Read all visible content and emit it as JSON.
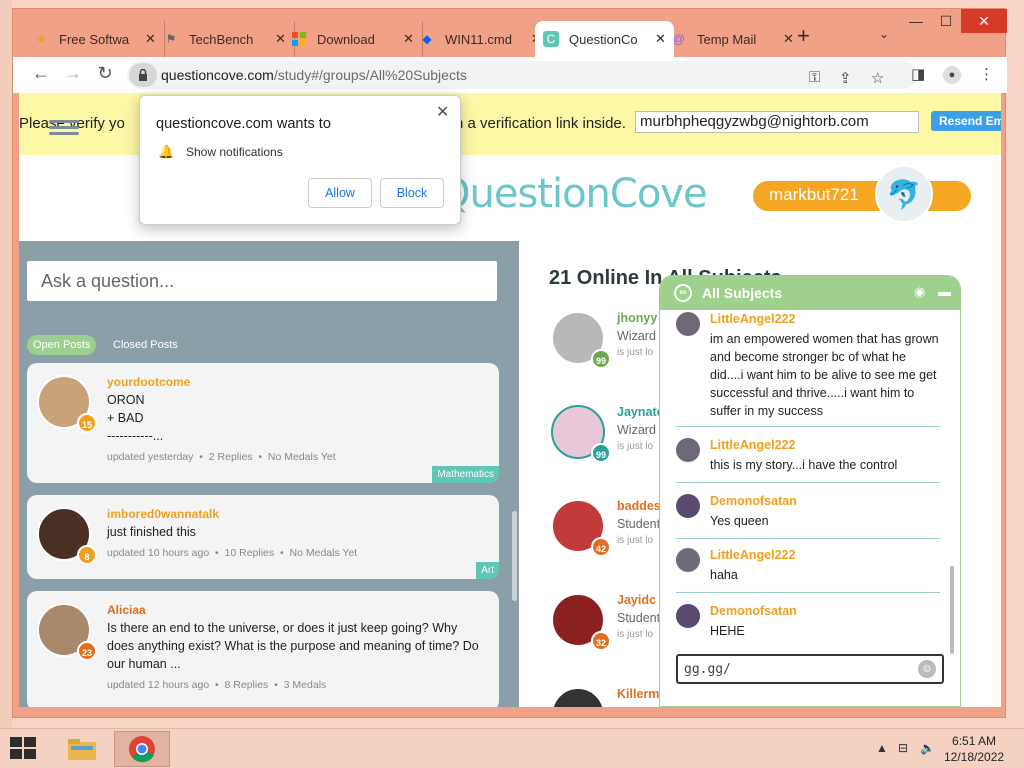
{
  "tabs": [
    {
      "label": "Free Softwa",
      "icon": "star-icon",
      "icon_color": "#f0a020"
    },
    {
      "label": "TechBench",
      "icon": "windows-icon",
      "icon_color": "#555555"
    },
    {
      "label": "Download",
      "icon": "microsoft-icon",
      "icon_color": "#00a4ef"
    },
    {
      "label": "WIN11.cmd",
      "icon": "dropbox-icon",
      "icon_color": "#0061ff"
    },
    {
      "label": "QuestionCo",
      "icon": "questioncove-icon",
      "icon_color": "#5ec8b5"
    },
    {
      "label": "Temp Mail",
      "icon": "at-icon",
      "icon_color": "#8a5cf6"
    }
  ],
  "address": {
    "domain": "questioncove.com",
    "path": "/study#/groups/All%20Subjects"
  },
  "verify": {
    "text_left": "Please verify yo",
    "text_right": "n a verification link inside.",
    "email": "murbhpheqgyzwbg@nightorb.com",
    "resend": "Resend Em"
  },
  "notification": {
    "title": "questioncove.com wants to",
    "option": "Show notifications",
    "allow": "Allow",
    "block": "Block"
  },
  "header": {
    "logo": "QuestionCove",
    "username": "markbut721"
  },
  "ask_placeholder": "Ask a question...",
  "post_tabs": {
    "open": "Open Posts",
    "closed": "Closed Posts"
  },
  "posts": [
    {
      "user": "yourdootcome",
      "level": "15",
      "body": "ORON\n+ BAD\n-----------...",
      "updated": "updated yesterday",
      "replies": "2 Replies",
      "medals": "No Medals Yet",
      "subject": "Mathematics"
    },
    {
      "user": "imbored0wannatalk",
      "level": "8",
      "body": "just finished this",
      "updated": "updated 10 hours ago",
      "replies": "10 Replies",
      "medals": "No Medals Yet",
      "subject": "Art"
    },
    {
      "user": "Aliciaa",
      "level": "23",
      "body": "Is there an end to the universe, or does it just keep going? Why does anything exist? What is the purpose and meaning of time? Do our human ...",
      "updated": "updated 12 hours ago",
      "replies": "8 Replies",
      "medals": "3 Medals",
      "subject": ""
    }
  ],
  "online": {
    "title": "21 Online In All Subjects",
    "users": [
      {
        "name": "jhonyy",
        "role": "Wizard",
        "status": "is just lo",
        "level": "99",
        "name_color": "#6aa84f",
        "badge_color": "#6aa84f"
      },
      {
        "name": "Jaynato",
        "role": "Wizard",
        "status": "is just lo",
        "level": "99",
        "name_color": "#2aa198",
        "badge_color": "#2aa198"
      },
      {
        "name": "baddes",
        "role": "Student",
        "status": "is just lo",
        "level": "42",
        "name_color": "#e07020",
        "badge_color": "#e07020"
      },
      {
        "name": "Jayidc",
        "role": "Student",
        "status": "is just lo",
        "level": "32",
        "name_color": "#e07020",
        "badge_color": "#e07020"
      },
      {
        "name": "Killerm",
        "role": "",
        "status": "",
        "level": "",
        "name_color": "#e07020",
        "badge_color": "#e07020"
      }
    ]
  },
  "chat": {
    "title": "All Subjects",
    "messages": [
      {
        "user": "LittleAngel222",
        "text": "im an empowered women that has grown and become stronger bc of what he did....i want him to be alive to see me get successful and thrive.....i want him to suffer in my success"
      },
      {
        "user": "LittleAngel222",
        "text": "this is my story...i have the control"
      },
      {
        "user": "Demonofsatan",
        "text": "Yes queen"
      },
      {
        "user": "LittleAngel222",
        "text": "haha"
      },
      {
        "user": "Demonofsatan",
        "text": "HEHE"
      }
    ],
    "input_value": "gg.gg/"
  },
  "taskbar": {
    "time": "6:51 AM",
    "date": "12/18/2022"
  },
  "colors": {
    "tabbar": "#f2a189",
    "chat_green": "#9fd08e",
    "accent_orange": "#f5a623",
    "teal": "#5ec8b5"
  }
}
